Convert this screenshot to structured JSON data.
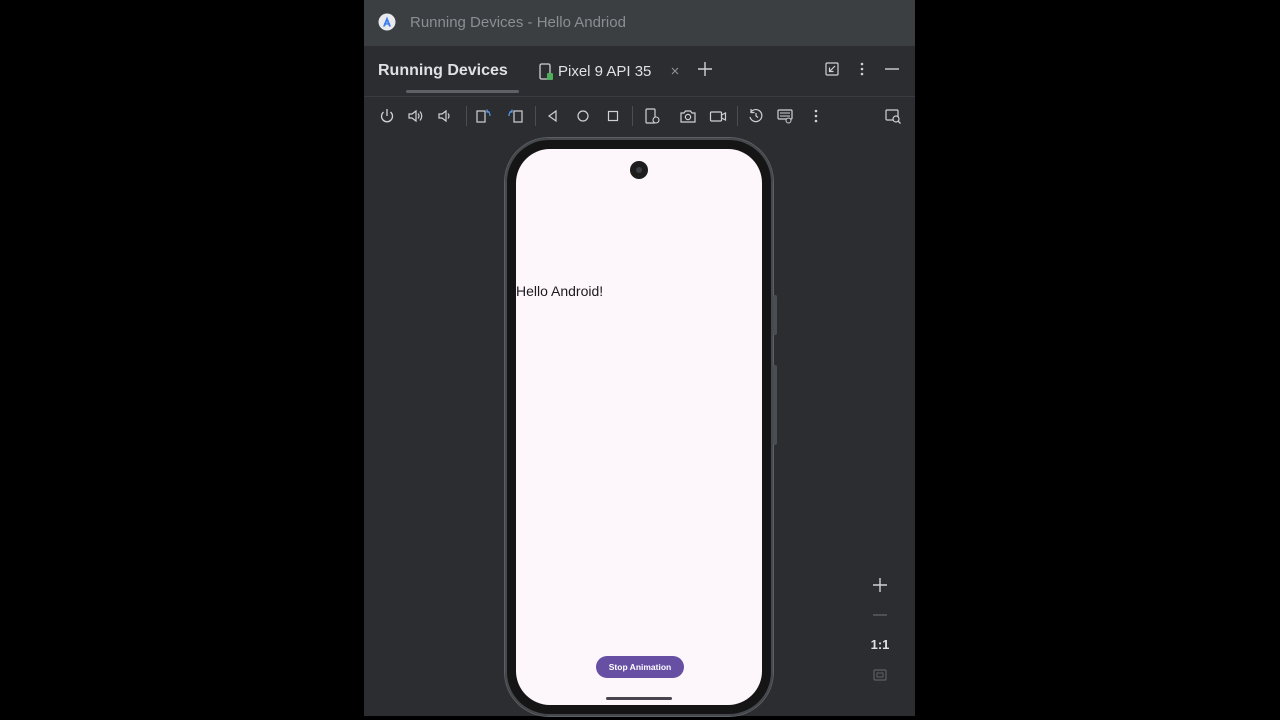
{
  "window": {
    "title": "Running Devices - Hello Andriod"
  },
  "panel": {
    "title": "Running Devices",
    "tabs": [
      {
        "label": "Pixel 9 API 35",
        "active": true
      }
    ]
  },
  "header_actions": [
    {
      "name": "restore-layout-icon"
    },
    {
      "name": "more-options-icon"
    },
    {
      "name": "minimize-icon"
    }
  ],
  "toolbar": {
    "buttons": [
      "power-icon",
      "volume-up-icon",
      "volume-down-icon",
      "rotate-left-icon",
      "rotate-right-icon",
      "back-icon",
      "home-icon",
      "overview-icon",
      "device-settings-icon",
      "screenshot-icon",
      "screen-record-icon",
      "snapshot-icon",
      "extended-controls-icon",
      "more-options-icon",
      "layout-inspector-icon"
    ]
  },
  "app": {
    "greeting": "Hello Android!",
    "button_label": "Stop Animation",
    "accent_color": "#6750a4",
    "background_color": "#fdf7fb"
  },
  "zoom": {
    "actual_size_label": "1:1"
  },
  "colors": {
    "window_bg": "#2b2d30",
    "titlebar_bg": "#3c3f41",
    "text_primary": "#dfe1e5",
    "text_muted": "#8b8e92"
  }
}
